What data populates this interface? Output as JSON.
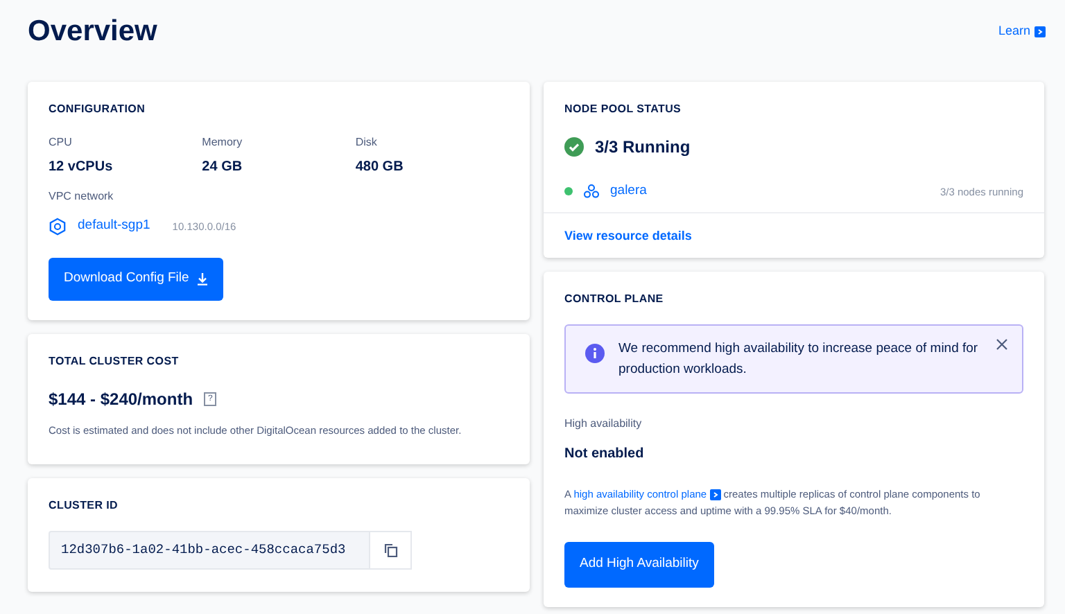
{
  "page": {
    "title": "Overview",
    "learn_link": "Learn"
  },
  "configuration": {
    "heading": "CONFIGURATION",
    "specs": [
      {
        "label": "CPU",
        "value": "12 vCPUs"
      },
      {
        "label": "Memory",
        "value": "24 GB"
      },
      {
        "label": "Disk",
        "value": "480 GB"
      }
    ],
    "vpc_label": "VPC network",
    "vpc_name": "default-sgp1",
    "vpc_range": "10.130.0.0/16",
    "button": "Download Config File"
  },
  "cost": {
    "heading": "TOTAL CLUSTER COST",
    "amount": "$144 - $240/month",
    "help": "?",
    "note": "Cost is estimated and does not include other DigitalOcean resources added to the cluster."
  },
  "cluster_id": {
    "heading": "CLUSTER ID",
    "value": "12d307b6-1a02-41bb-acec-458ccaca75d3"
  },
  "node_pool_status": {
    "heading": "NODE POOL STATUS",
    "summary": "3/3 Running",
    "pools": [
      {
        "name": "galera",
        "status": "3/3 nodes running",
        "color": "#3ec16f"
      }
    ],
    "link": "View resource details"
  },
  "control_plane": {
    "heading": "CONTROL PLANE",
    "alert": "We recommend high availability to increase peace of mind for production workloads.",
    "ha_label": "High availability",
    "ha_value": "Not enabled",
    "desc_before": "A",
    "desc_link": "high availability control plane",
    "desc_after": "creates multiple replicas of control plane components to maximize cluster access and uptime with a 99.95% SLA for $40/month.",
    "button": "Add High Availability"
  }
}
